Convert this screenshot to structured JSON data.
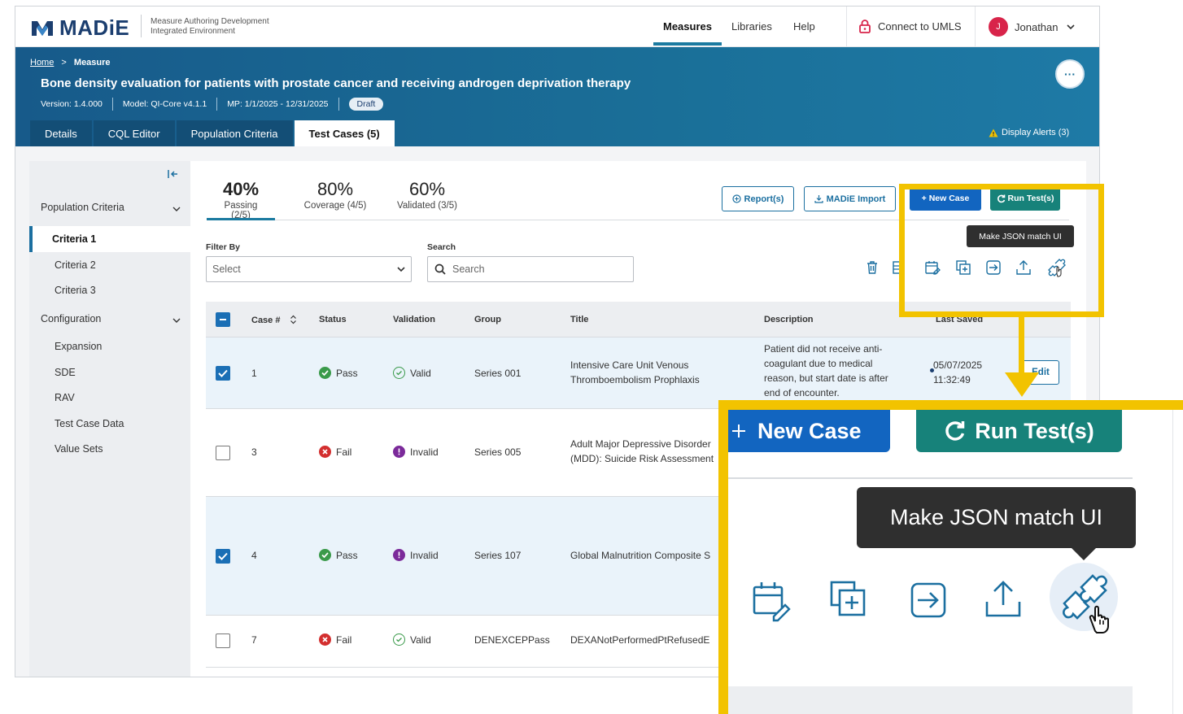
{
  "topnav": {
    "logo_text": "MADiE",
    "logo_subtitle_1": "Measure Authoring Development",
    "logo_subtitle_2": "Integrated Environment",
    "links": [
      "Measures",
      "Libraries",
      "Help"
    ],
    "umls_label": "Connect to UMLS",
    "user_initial": "J",
    "user_name": "Jonathan"
  },
  "measure": {
    "crumb_home": "Home",
    "crumb_sep": ">",
    "crumb_current": "Measure",
    "title": "Bone density evaluation for patients with prostate cancer and receiving androgen deprivation therapy",
    "version": "Version: 1.4.000",
    "model": "Model: QI-Core v4.1.1",
    "period": "MP: 1/1/2025 - 12/31/2025",
    "status": "Draft",
    "more_label": "···",
    "tabs": [
      "Details",
      "CQL Editor",
      "Population Criteria",
      "Test Cases (5)"
    ],
    "alerts": "Display Alerts (3)"
  },
  "sidebar": {
    "population_criteria": "Population Criteria",
    "criteria": [
      "Criteria 1",
      "Criteria 2",
      "Criteria 3"
    ],
    "configuration": "Configuration",
    "config_items": [
      "Expansion",
      "SDE",
      "RAV",
      "Test Case Data",
      "Value Sets"
    ]
  },
  "stats": [
    {
      "value": "40%",
      "label": "Passing (2/5)"
    },
    {
      "value": "80%",
      "label": "Coverage (4/5)"
    },
    {
      "value": "60%",
      "label": "Validated (3/5)"
    }
  ],
  "toolbar": {
    "report": "Report(s)",
    "import": "MADiE Import",
    "new_case": "+ New Case",
    "run_tests": "Run Test(s)",
    "filter_label": "Filter By",
    "filter_value": "Select",
    "search_label": "Search",
    "search_placeholder": "Search",
    "tooltip": "Make JSON match UI"
  },
  "table": {
    "headers": [
      "Case #",
      "Status",
      "Validation",
      "Group",
      "Title",
      "Description",
      "Last Saved"
    ],
    "rows": [
      {
        "case": "1",
        "status": "Pass",
        "validation": "Valid",
        "group": "Series 001",
        "title_1": "Intensive Care Unit Venous",
        "title_2": "Thromboembolism Prophlaxis",
        "desc_1": "Patient did not receive anti-",
        "desc_2": "coagulant due to medical",
        "desc_3": "reason, but start date is after",
        "desc_4": "end of encounter.",
        "saved_1": "05/07/2025",
        "saved_2": "11:32:49",
        "edit": "Edit"
      },
      {
        "case": "3",
        "status": "Fail",
        "validation": "Invalid",
        "group": "Series 005",
        "title_1": "Adult Major Depressive Disorder",
        "title_2": "(MDD): Suicide Risk Assessment"
      },
      {
        "case": "4",
        "status": "Pass",
        "validation": "Invalid",
        "group": "Series 107",
        "title_1": "Global Malnutrition Composite S"
      },
      {
        "case": "7",
        "status": "Fail",
        "validation": "Valid",
        "group": "DENEXCEPPass",
        "title_1": "DEXANotPerformedPtRefusedE"
      }
    ]
  },
  "zoom": {
    "new_case": "New Case",
    "run_tests": "Run Test(s)",
    "tooltip": "Make JSON match UI"
  },
  "colors": {
    "brand": "#1b3e6f",
    "header": "#1a6f98",
    "primary_button": "#1265c0",
    "run_button": "#17827a",
    "pass": "#3a9a4a",
    "fail": "#d32f2f",
    "invalid": "#7b2a9a",
    "highlight": "#f2c300"
  }
}
